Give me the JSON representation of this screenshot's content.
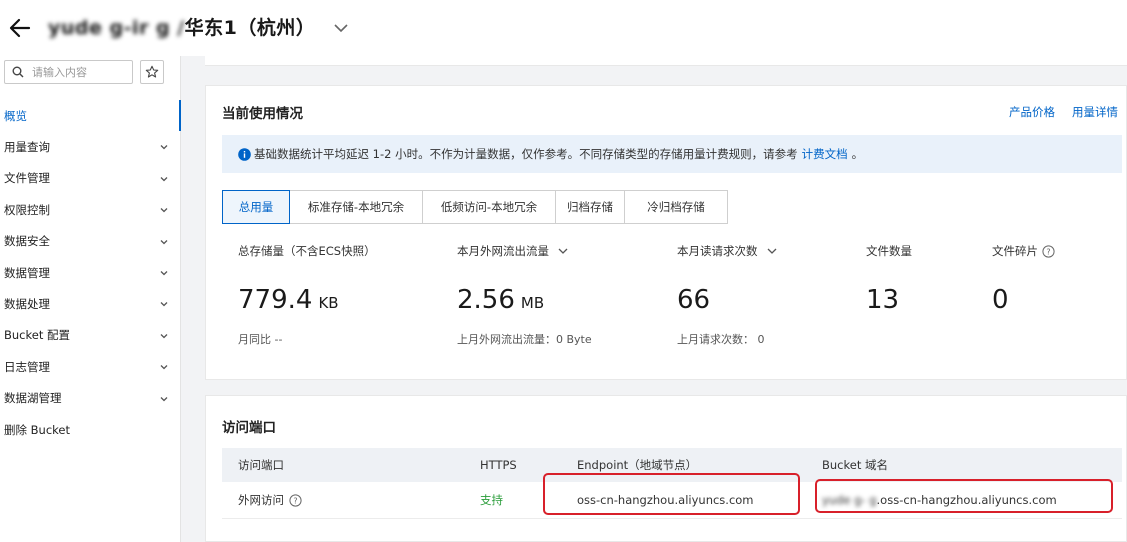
{
  "header": {
    "bucket_name_masked": "yude  g-ir  g /",
    "region": "华东1（杭州）"
  },
  "sidebar": {
    "search_placeholder": "请输入内容",
    "items": [
      {
        "label": "概览",
        "active": true,
        "expandable": false
      },
      {
        "label": "用量查询",
        "active": false,
        "expandable": true
      },
      {
        "label": "文件管理",
        "active": false,
        "expandable": true
      },
      {
        "label": "权限控制",
        "active": false,
        "expandable": true
      },
      {
        "label": "数据安全",
        "active": false,
        "expandable": true
      },
      {
        "label": "数据管理",
        "active": false,
        "expandable": true
      },
      {
        "label": "数据处理",
        "active": false,
        "expandable": true
      },
      {
        "label": "Bucket 配置",
        "active": false,
        "expandable": true
      },
      {
        "label": "日志管理",
        "active": false,
        "expandable": true
      },
      {
        "label": "数据湖管理",
        "active": false,
        "expandable": true
      },
      {
        "label": "删除 Bucket",
        "active": false,
        "expandable": false
      }
    ]
  },
  "usage": {
    "title": "当前使用情况",
    "price_link": "产品价格",
    "detail_link": "用量详情",
    "notice_text": "基础数据统计平均延迟 1-2 小时。不作为计量数据，仅作参考。不同存储类型的存储用量计费规则，请参考",
    "notice_link": "计费文档",
    "notice_end": "。",
    "tabs": [
      "总用量",
      "标准存储-本地冗余",
      "低频访问-本地冗余",
      "归档存储",
      "冷归档存储"
    ],
    "metrics": {
      "storage": {
        "label": "总存储量（不含ECS快照）",
        "value": "779.4",
        "unit": "KB",
        "sub_label": "月同比",
        "sub_value": "--"
      },
      "traffic": {
        "label": "本月外网流出流量",
        "value": "2.56",
        "unit": "MB",
        "sub": "上月外网流出流量：0 Byte"
      },
      "requests": {
        "label": "本月读请求次数",
        "value": "66",
        "sub": "上月请求次数： 0"
      },
      "files": {
        "label": "文件数量",
        "value": "13"
      },
      "fragments": {
        "label": "文件碎片",
        "value": "0"
      }
    }
  },
  "access": {
    "title": "访问端口",
    "headers": [
      "访问端口",
      "HTTPS",
      "Endpoint（地域节点）",
      "Bucket 域名"
    ],
    "row": {
      "port": "外网访问",
      "https": "支持",
      "endpoint": "oss-cn-hangzhou.aliyuncs.com",
      "domain_masked": "yude  g-   g",
      "domain_suffix": ".oss-cn-hangzhou.aliyuncs.com"
    }
  },
  "colors": {
    "accent": "#0064c8",
    "success": "#2a9d3a",
    "highlight": "#d8202a",
    "notice_bg": "#e9f1fa"
  }
}
